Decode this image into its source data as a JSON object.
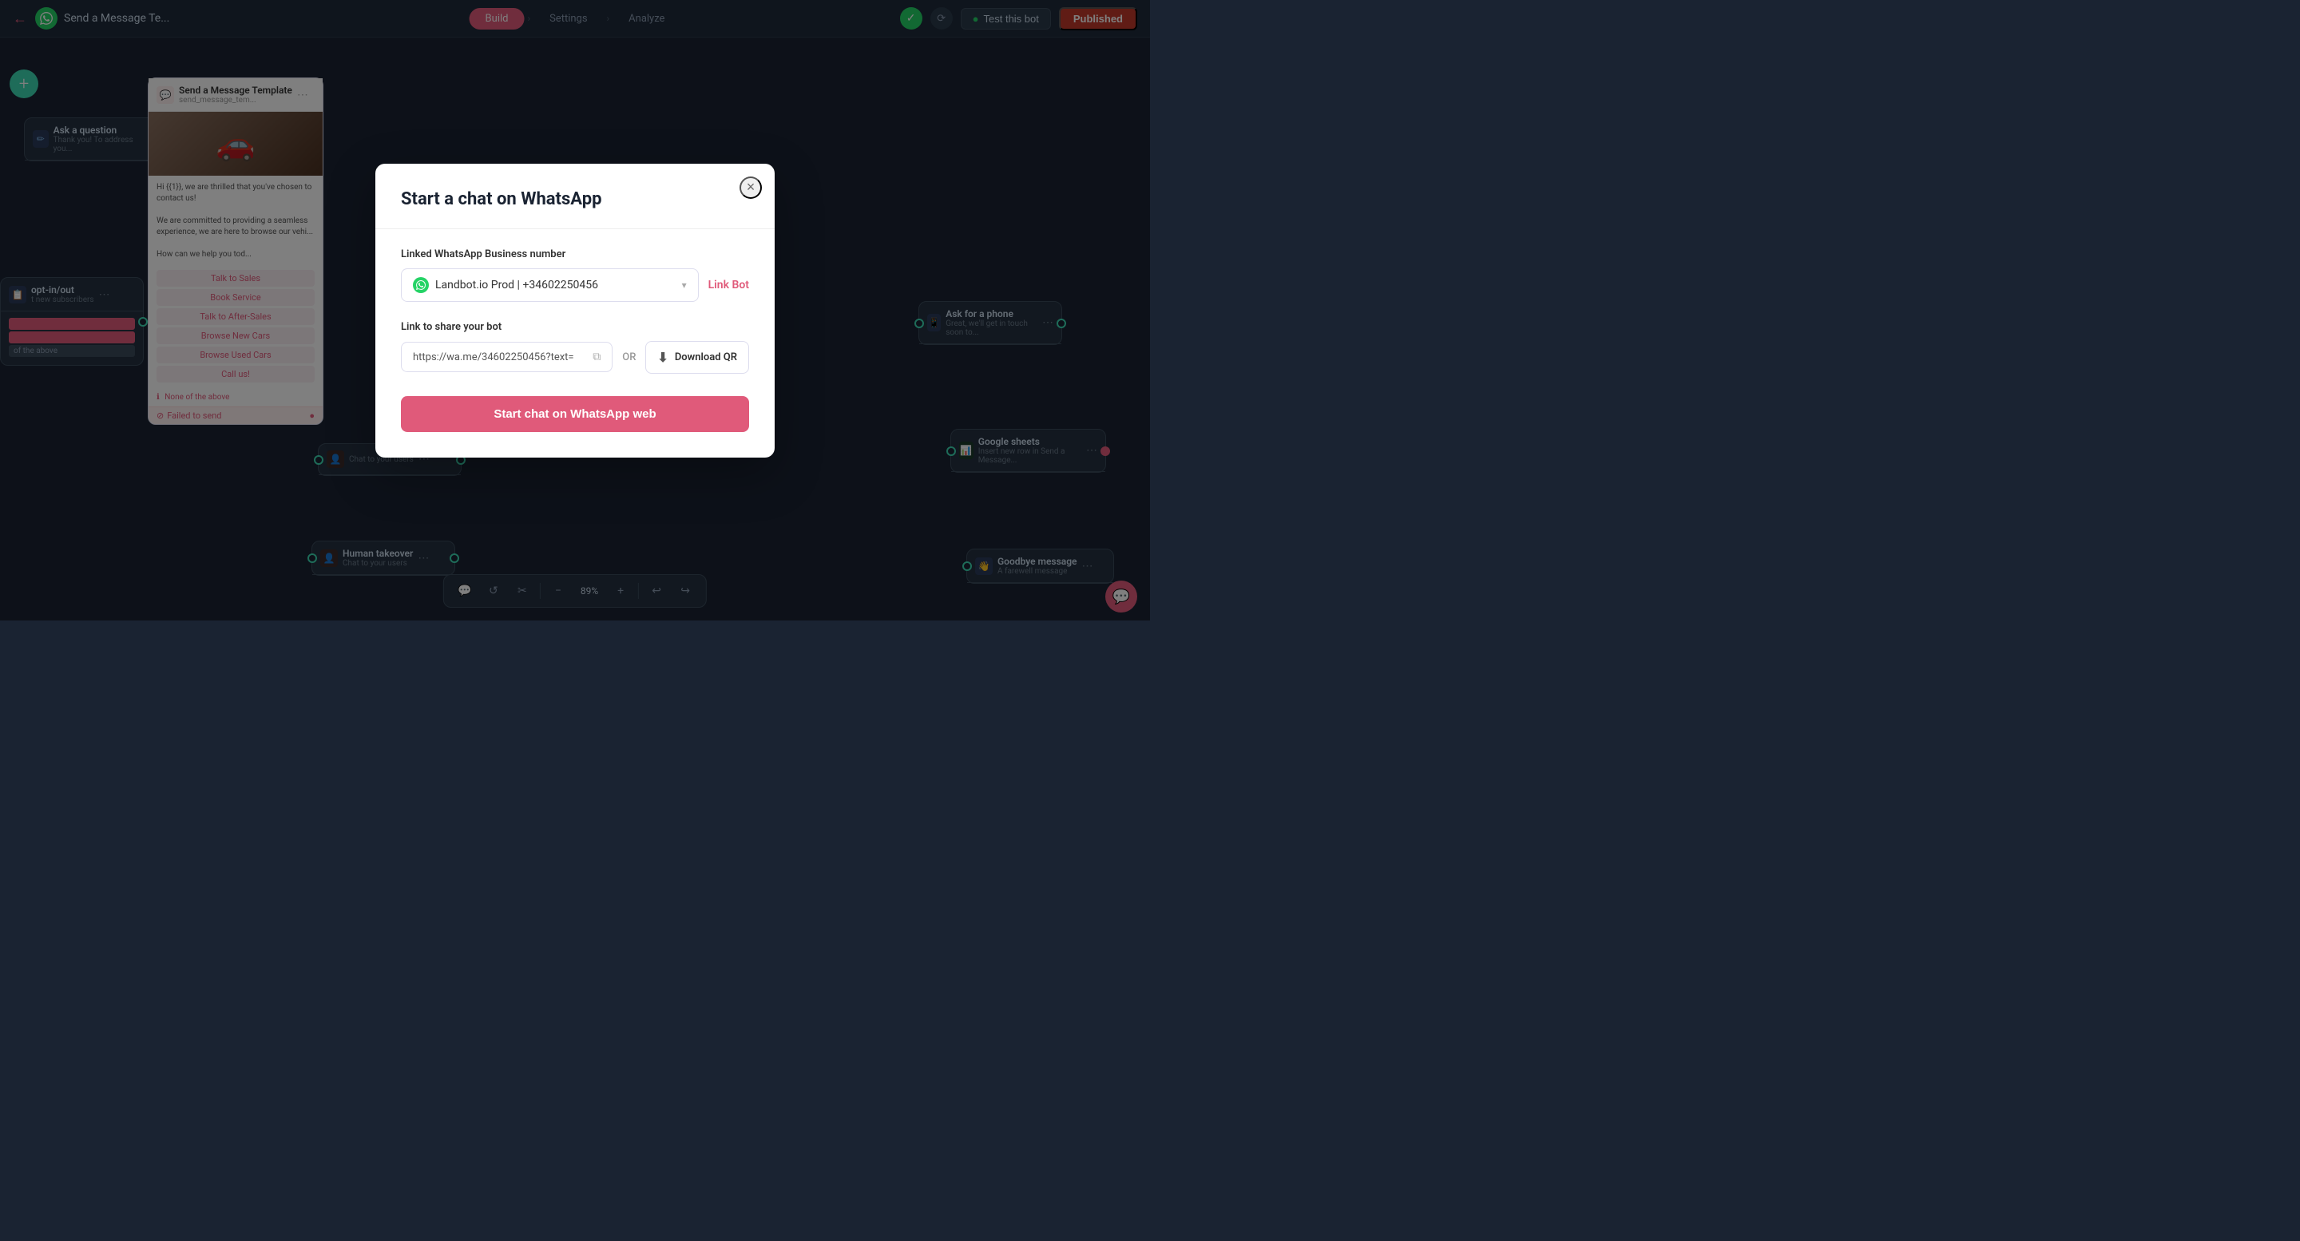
{
  "topbar": {
    "back_icon": "←",
    "logo_icon": "●",
    "title": "Send a Message Te...",
    "nav": {
      "build_label": "Build",
      "settings_label": "Settings",
      "analyze_label": "Analyze",
      "arrow": "›"
    },
    "test_bot_label": "Test this bot",
    "published_label": "Published",
    "whatsapp_icon": "●"
  },
  "canvas": {
    "add_btn": "+"
  },
  "nodes": {
    "send_message_template": {
      "title": "Send a Message Template",
      "subtitle": "send_message_tem...",
      "dots": "⋯",
      "body_text_1": "Hi {{1}}, we are thrilled that you've chosen to contact us!",
      "body_text_2": "We are committed to providing a seamless experience, we are here to browse our vehi...",
      "body_text_3": "How can we help you tod...",
      "buttons": [
        "Talk to Sales",
        "Book Service",
        "Talk to After-Sales",
        "Browse New Cars",
        "Browse Used Cars",
        "Call us!"
      ],
      "none_above": "None of the above",
      "failed_to_send": "Failed to send"
    },
    "ask_question": {
      "title": "Ask a question",
      "subtitle": "Thank you! To address you...",
      "dots": "⋯"
    },
    "opt_in_out": {
      "title": "opt-in/out",
      "subtitle": "t new subscribers",
      "dots": "⋯",
      "choices": [
        "(choice)",
        "(choice)",
        "of the above"
      ]
    },
    "ask_phone": {
      "title": "Ask for a phone",
      "subtitle": "Great, we'll get in touch soon to...",
      "dots": "⋯"
    },
    "human_takeover": {
      "title": "Human takeover",
      "subtitle": "Chat to your users",
      "dots": "⋯"
    },
    "google_sheets": {
      "title": "Google sheets",
      "subtitle": "Insert new row in Send a Message...",
      "dots": "⋯"
    },
    "goodbye": {
      "title": "Goodbye message",
      "subtitle": "A farewell message",
      "dots": "⋯"
    },
    "chat_users": {
      "subtitle": "Chat to your users",
      "dots": "⋯"
    }
  },
  "modal": {
    "title": "Start a chat on WhatsApp",
    "close_icon": "×",
    "linked_number_label": "Linked WhatsApp Business number",
    "selected_number": "Landbot.io Prod | +34602250456",
    "link_bot_label": "Link Bot",
    "link_share_label": "Link to share your bot",
    "link_url": "https://wa.me/34602250456?text=",
    "or_text": "OR",
    "download_qr_label": "Download QR",
    "start_chat_label": "Start chat on WhatsApp web",
    "whatsapp_icon": "●",
    "chevron": "▾",
    "copy_icon": "⧉",
    "download_icon": "⬇"
  },
  "toolbar": {
    "zoom_level": "89%",
    "icons": {
      "message": "💬",
      "refresh": "↺",
      "scissors": "✂",
      "minus": "−",
      "plus": "+",
      "undo": "↩",
      "redo": "↪"
    }
  }
}
